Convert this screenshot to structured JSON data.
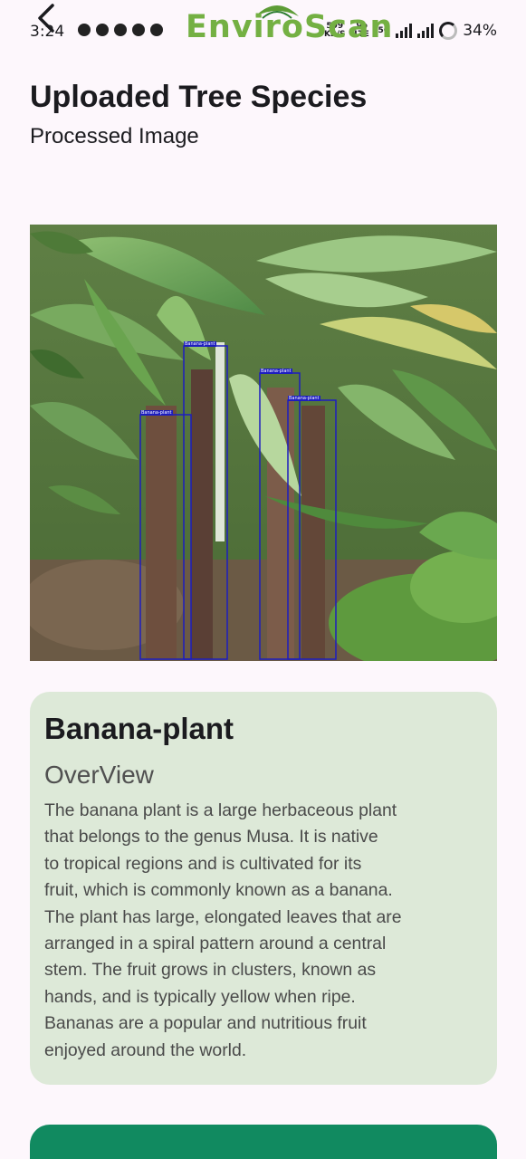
{
  "status_bar": {
    "time": "3:24",
    "net_speed_value": "599",
    "net_speed_unit": "KB/S",
    "network_label": "5G",
    "volte_label": "Vo LTE",
    "battery": "34%"
  },
  "app": {
    "brand": "EnviroScan",
    "brand_color": "#74b043"
  },
  "header": {
    "title": "Uploaded Tree Species",
    "subtitle": "Processed Image"
  },
  "image": {
    "box_color": "#1d1dbf",
    "detection_labels": [
      "Banana-plant",
      "Banana-plant",
      "Banana-plant",
      "Banana-plant"
    ]
  },
  "info_card": {
    "species": "Banana-plant",
    "overview_heading": "OverView",
    "overview_lines": [
      "The banana plant is a large herbaceous plant",
      "that belongs to the genus Musa. It is native",
      "to tropical regions and is cultivated for its",
      "fruit, which is commonly known as a banana.",
      "The plant has large, elongated leaves that are",
      "arranged in a spiral pattern around a central",
      "stem. The fruit grows in clusters, known as",
      "hands, and is typically yellow when ripe.",
      "Bananas are a popular and nutritious fruit",
      "enjoyed around the world."
    ],
    "card_color": "#dde9d8"
  },
  "colors": {
    "background": "#fdf7fc",
    "bottom_button": "#118a60"
  }
}
